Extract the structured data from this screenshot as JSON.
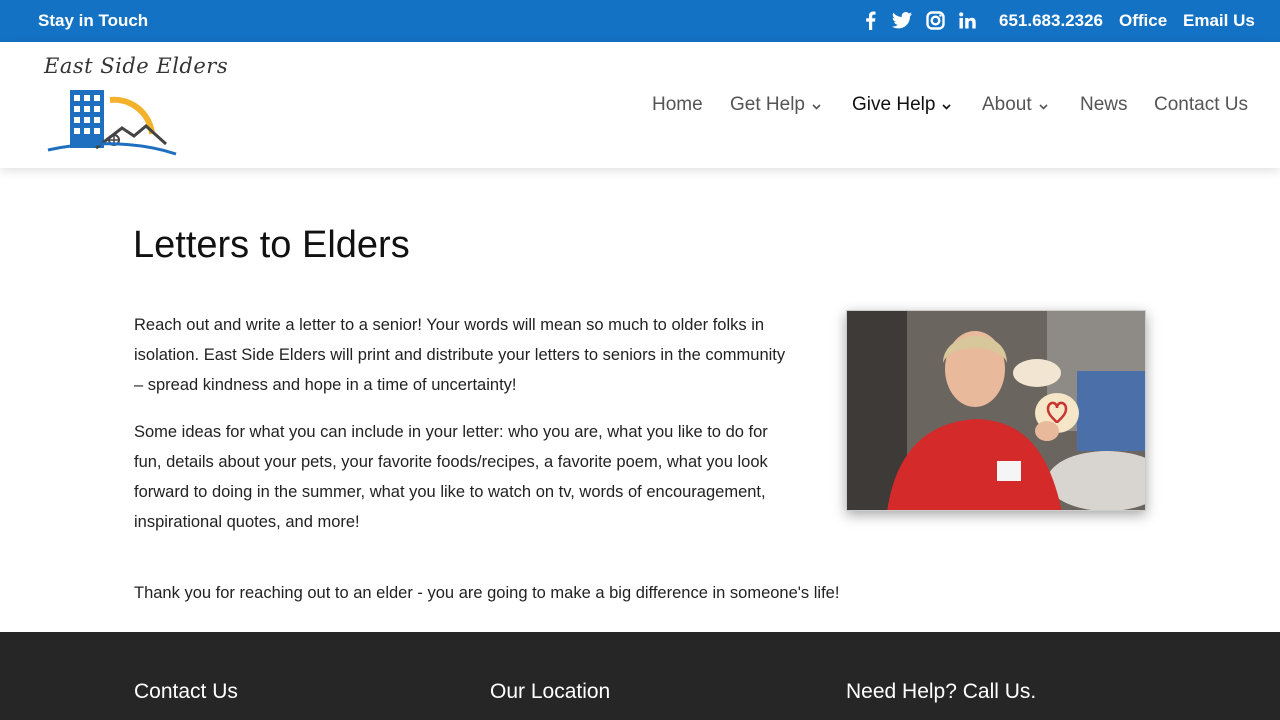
{
  "topbar": {
    "tagline": "Stay in Touch",
    "phone": "651.683.2326",
    "office": "Office",
    "email": "Email Us",
    "social_icons": [
      "facebook-icon",
      "twitter-icon",
      "instagram-icon",
      "linkedin-icon"
    ],
    "background_color": "#1472c4"
  },
  "header": {
    "logo_text": "East Side Elders",
    "nav": [
      {
        "label": "Home",
        "has_dropdown": false
      },
      {
        "label": "Get Help",
        "has_dropdown": true
      },
      {
        "label": "Give Help",
        "has_dropdown": true,
        "active": true
      },
      {
        "label": "About",
        "has_dropdown": true
      },
      {
        "label": "News",
        "has_dropdown": false
      },
      {
        "label": "Contact Us",
        "has_dropdown": false
      }
    ]
  },
  "main": {
    "title": "Letters to Elders",
    "paragraphs": [
      "Reach out and write a letter to a senior!  Your words will mean so much to older folks in isolation.  East Side Elders will print and distribute your letters to seniors in the community – spread kindness and hope in a time of uncertainty!",
      "Some ideas for what you can include in your letter:  who you are, what you like to do for fun, details about your pets, your favorite foods/recipes, a favorite poem, what you look forward to doing in the summer, what you like to watch on tv, words of encouragement, inspirational quotes, and more!",
      "Thank you for reaching out to an elder - you are going to make a big difference in someone's life!"
    ]
  },
  "footer": {
    "headings": [
      "Contact Us",
      "Our Location",
      "Need Help?  Call Us."
    ],
    "background_color": "#262626"
  }
}
